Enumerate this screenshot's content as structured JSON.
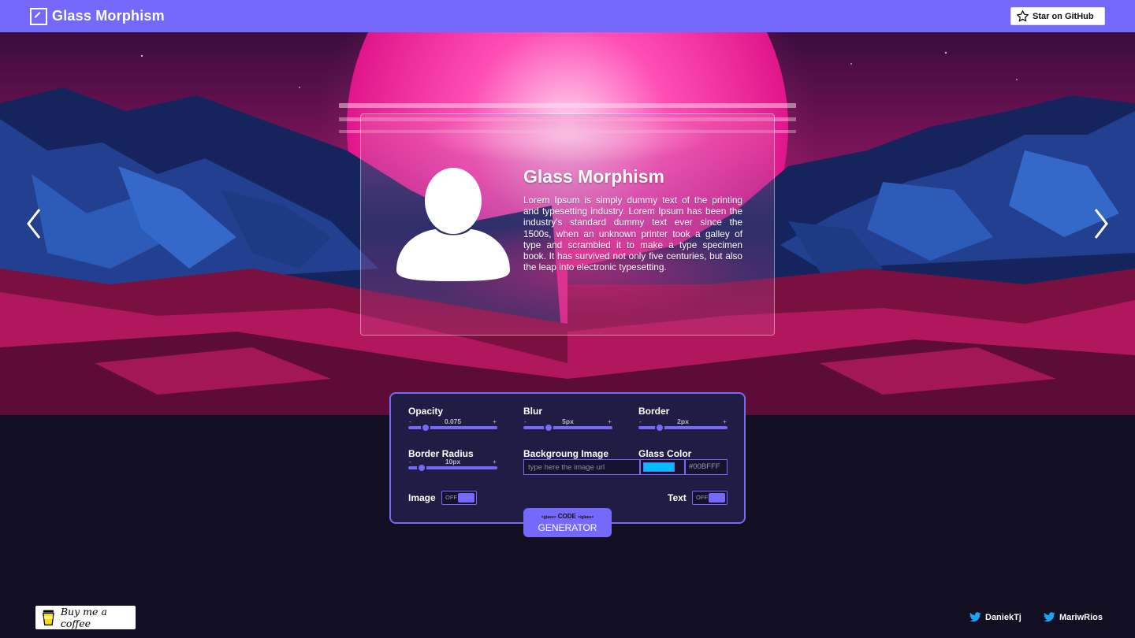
{
  "header": {
    "title": "Glass Morphism",
    "github_label": "Star on GitHub"
  },
  "card": {
    "title": "Glass Morphism",
    "text": "Lorem Ipsum is simply dummy text of the printing and typesetting industry. Lorem Ipsum has been the industry's standard dummy text ever since the 1500s, when an unknown printer took a galley of type and scrambled it to make a type specimen book. It has survived not only five centuries, but also the leap into electronic typesetting."
  },
  "controls": {
    "opacity": {
      "label": "Opacity",
      "value": "0.075",
      "minus": "-",
      "plus": "+"
    },
    "blur": {
      "label": "Blur",
      "value": "5px",
      "minus": "-",
      "plus": "+"
    },
    "border": {
      "label": "Border",
      "value": "2px",
      "minus": "-",
      "plus": "+"
    },
    "border_radius": {
      "label": "Border Radius",
      "value": "10px",
      "minus": "-",
      "plus": "+"
    },
    "background_image": {
      "label": "Backgroung Image",
      "placeholder": "type here the image url"
    },
    "glass_color": {
      "label": "Glass Color",
      "value": "#00BFFF",
      "color": "#00bfff"
    },
    "image_toggle": {
      "label": "Image",
      "state": "OFF"
    },
    "text_toggle": {
      "label": "Text",
      "state": "OFF"
    }
  },
  "generator": {
    "tag_open": "<glass>",
    "code": "CODE",
    "tag_close": "</glass>",
    "label": "GENERATOR"
  },
  "footer": {
    "coffee_label": "Buy me a coffee",
    "twitter_1": "DaniekTj",
    "twitter_2": "MariwRios"
  },
  "colors": {
    "accent": "#7469fb",
    "panel": "#201c44",
    "page_bg": "#110f21",
    "twitter": "#1da1f2"
  },
  "icons": [
    "logo-icon",
    "star-icon",
    "chevron-left-icon",
    "chevron-right-icon",
    "user-avatar-icon",
    "coffee-cup-icon",
    "twitter-icon"
  ]
}
